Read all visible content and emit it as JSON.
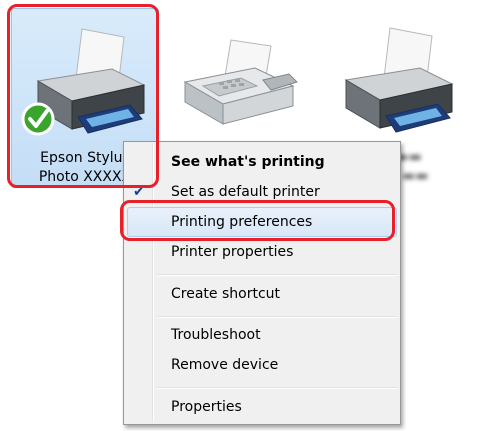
{
  "devices": [
    {
      "name_line1": "Epson Stylus",
      "name_line2": "Photo XXXXX",
      "icon": "printer-icon",
      "default": true
    },
    {
      "name_line1": "",
      "name_line2": "",
      "icon": "fax-icon"
    },
    {
      "name_line1": "",
      "name_line2": "",
      "icon": "printer-icon"
    }
  ],
  "context_menu": {
    "items": [
      {
        "label": "See what's printing",
        "bold": true
      },
      {
        "label": "Set as default printer",
        "checked": true
      },
      {
        "label": "Printing preferences",
        "highlighted": true
      },
      {
        "label": "Printer properties"
      },
      {
        "label": "Create shortcut"
      },
      {
        "label": "Troubleshoot"
      },
      {
        "label": "Remove device"
      },
      {
        "label": "Properties"
      }
    ],
    "check_icon": "checkmark-icon"
  },
  "colors": {
    "highlight_outline": "#e8202a",
    "selection_fill": "#c4def6",
    "menu_background": "#f0f0f0",
    "default_badge": "#3aa52c"
  }
}
